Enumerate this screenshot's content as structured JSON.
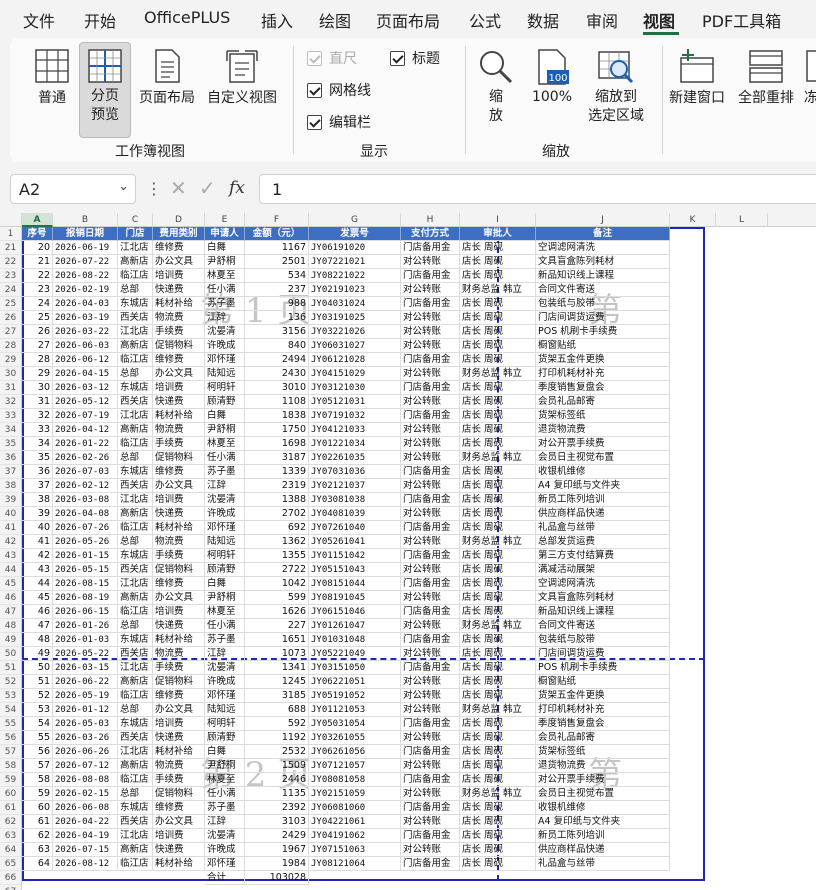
{
  "menu": {
    "items": [
      "文件",
      "开始",
      "OfficePLUS",
      "插入",
      "绘图",
      "页面布局",
      "公式",
      "数据",
      "审阅",
      "视图",
      "PDF工具箱"
    ],
    "active": "视图"
  },
  "ribbon": {
    "normal": "普通",
    "pagebreak_line1": "分页",
    "pagebreak_line2": "预览",
    "pagelayout": "页面布局",
    "customview": "自定义视图",
    "group_workbook_views": "工作簿视图",
    "ruler": "直尺",
    "headings": "标题",
    "gridlines": "网格线",
    "formulabar": "编辑栏",
    "group_show": "显示",
    "zoom_line1": "缩",
    "zoom_line2": "放",
    "zoom100": "100%",
    "zoom_sel_line1": "缩放到",
    "zoom_sel_line2": "选定区域",
    "group_zoom": "缩放",
    "new_window": "新建窗口",
    "arrange_all": "全部重排",
    "freeze": "冻"
  },
  "formula_bar": {
    "namebox": "A2",
    "formula": "1"
  },
  "columns": [
    "A",
    "B",
    "C",
    "D",
    "E",
    "F",
    "G",
    "H",
    "I",
    "J",
    "K",
    "L"
  ],
  "table_headers": [
    "序号",
    "报销日期",
    "门店",
    "费用类别",
    "申请人",
    "金额（元）",
    "发票号",
    "支付方式",
    "审批人",
    "备注"
  ],
  "rows": [
    [
      "20",
      "2026-06-19",
      "江北店",
      "维修费",
      "白舞",
      "1167",
      "JY06191020",
      "门店备用金",
      "店长 周砚",
      "空调滤网清洗"
    ],
    [
      "21",
      "2026-07-22",
      "高新店",
      "办公文具",
      "尹舒桐",
      "2501",
      "JY07221021",
      "对公转账",
      "店长 周砚",
      "文具盲盒陈列耗材"
    ],
    [
      "22",
      "2026-08-22",
      "临江店",
      "培训费",
      "林夏至",
      "534",
      "JY08221022",
      "门店备用金",
      "店长 周砚",
      "新品知识线上课程"
    ],
    [
      "23",
      "2026-02-19",
      "总部",
      "快递费",
      "任小满",
      "237",
      "JY02191023",
      "对公转账",
      "财务总监 韩立",
      "合同文件寄送"
    ],
    [
      "24",
      "2026-04-03",
      "东城店",
      "耗材补给",
      "苏子墨",
      "988",
      "JY04031024",
      "门店备用金",
      "店长 周砚",
      "包装纸与胶带"
    ],
    [
      "25",
      "2026-03-19",
      "西关店",
      "物流费",
      "江辞",
      "136",
      "JY03191025",
      "对公转账",
      "店长 周砚",
      "门店间调货运费"
    ],
    [
      "26",
      "2026-03-22",
      "江北店",
      "手续费",
      "沈晏清",
      "3156",
      "JY03221026",
      "对公转账",
      "店长 周砚",
      "POS 机刷卡手续费"
    ],
    [
      "27",
      "2026-06-03",
      "高新店",
      "促销物料",
      "许晚成",
      "840",
      "JY06031027",
      "对公转账",
      "店长 周砚",
      "橱窗贴纸"
    ],
    [
      "28",
      "2026-06-12",
      "临江店",
      "维修费",
      "邓怀瑾",
      "2494",
      "JY06121028",
      "门店备用金",
      "店长 周砚",
      "货架五金件更换"
    ],
    [
      "29",
      "2026-04-15",
      "总部",
      "办公文具",
      "陆知远",
      "2430",
      "JY04151029",
      "对公转账",
      "财务总监 韩立",
      "打印机耗材补充"
    ],
    [
      "30",
      "2026-03-12",
      "东城店",
      "培训费",
      "柯明轩",
      "3010",
      "JY03121030",
      "门店备用金",
      "店长 周砚",
      "季度销售复盘会"
    ],
    [
      "31",
      "2026-05-12",
      "西关店",
      "快递费",
      "顾清野",
      "1108",
      "JY05121031",
      "对公转账",
      "店长 周砚",
      "会员礼品邮寄"
    ],
    [
      "32",
      "2026-07-19",
      "江北店",
      "耗材补给",
      "白舞",
      "1838",
      "JY07191032",
      "门店备用金",
      "店长 周砚",
      "货架标签纸"
    ],
    [
      "33",
      "2026-04-12",
      "高新店",
      "物流费",
      "尹舒桐",
      "1750",
      "JY04121033",
      "对公转账",
      "店长 周砚",
      "退货物流费"
    ],
    [
      "34",
      "2026-01-22",
      "临江店",
      "手续费",
      "林夏至",
      "1698",
      "JY01221034",
      "对公转账",
      "店长 周砚",
      "对公开票手续费"
    ],
    [
      "35",
      "2026-02-26",
      "总部",
      "促销物料",
      "任小满",
      "3187",
      "JY02261035",
      "对公转账",
      "财务总监 韩立",
      "会员日主视觉布置"
    ],
    [
      "36",
      "2026-07-03",
      "东城店",
      "维修费",
      "苏子墨",
      "1339",
      "JY07031036",
      "门店备用金",
      "店长 周砚",
      "收银机维修"
    ],
    [
      "37",
      "2026-02-12",
      "西关店",
      "办公文具",
      "江辞",
      "2319",
      "JY02121037",
      "对公转账",
      "店长 周砚",
      "A4 复印纸与文件夹"
    ],
    [
      "38",
      "2026-03-08",
      "江北店",
      "培训费",
      "沈晏清",
      "1388",
      "JY03081038",
      "门店备用金",
      "店长 周砚",
      "新员工陈列培训"
    ],
    [
      "39",
      "2026-04-08",
      "高新店",
      "快递费",
      "许晚成",
      "2702",
      "JY04081039",
      "对公转账",
      "店长 周砚",
      "供应商样品快递"
    ],
    [
      "40",
      "2026-07-26",
      "临江店",
      "耗材补给",
      "邓怀瑾",
      "692",
      "JY07261040",
      "门店备用金",
      "店长 周砚",
      "礼品盒与丝带"
    ],
    [
      "41",
      "2026-05-26",
      "总部",
      "物流费",
      "陆知远",
      "1362",
      "JY05261041",
      "对公转账",
      "财务总监 韩立",
      "总部发货运费"
    ],
    [
      "42",
      "2026-01-15",
      "东城店",
      "手续费",
      "柯明轩",
      "1355",
      "JY01151042",
      "门店备用金",
      "店长 周砚",
      "第三方支付结算费"
    ],
    [
      "43",
      "2026-05-15",
      "西关店",
      "促销物料",
      "顾清野",
      "2722",
      "JY05151043",
      "对公转账",
      "店长 周砚",
      "满减活动展架"
    ],
    [
      "44",
      "2026-08-15",
      "江北店",
      "维修费",
      "白舞",
      "1042",
      "JY08151044",
      "门店备用金",
      "店长 周砚",
      "空调滤网清洗"
    ],
    [
      "45",
      "2026-08-19",
      "高新店",
      "办公文具",
      "尹舒桐",
      "599",
      "JY08191045",
      "对公转账",
      "店长 周砚",
      "文具盲盒陈列耗材"
    ],
    [
      "46",
      "2026-06-15",
      "临江店",
      "培训费",
      "林夏至",
      "1626",
      "JY06151046",
      "门店备用金",
      "店长 周砚",
      "新品知识线上课程"
    ],
    [
      "47",
      "2026-01-26",
      "总部",
      "快递费",
      "任小满",
      "227",
      "JY01261047",
      "对公转账",
      "财务总监 韩立",
      "合同文件寄送"
    ],
    [
      "48",
      "2026-01-03",
      "东城店",
      "耗材补给",
      "苏子墨",
      "1651",
      "JY01031048",
      "门店备用金",
      "店长 周砚",
      "包装纸与胶带"
    ],
    [
      "49",
      "2026-05-22",
      "西关店",
      "物流费",
      "江辞",
      "1073",
      "JY05221049",
      "对公转账",
      "店长 周砚",
      "门店间调货运费"
    ],
    [
      "50",
      "2026-03-15",
      "江北店",
      "手续费",
      "沈晏清",
      "1341",
      "JY03151050",
      "门店备用金",
      "店长 周砚",
      "POS 机刷卡手续费"
    ],
    [
      "51",
      "2026-06-22",
      "高新店",
      "促销物料",
      "许晚成",
      "1245",
      "JY06221051",
      "对公转账",
      "店长 周砚",
      "橱窗贴纸"
    ],
    [
      "52",
      "2026-05-19",
      "临江店",
      "维修费",
      "邓怀瑾",
      "3185",
      "JY05191052",
      "对公转账",
      "店长 周砚",
      "货架五金件更换"
    ],
    [
      "53",
      "2026-01-12",
      "总部",
      "办公文具",
      "陆知远",
      "688",
      "JY01121053",
      "对公转账",
      "财务总监 韩立",
      "打印机耗材补充"
    ],
    [
      "54",
      "2026-05-03",
      "东城店",
      "培训费",
      "柯明轩",
      "592",
      "JY05031054",
      "门店备用金",
      "店长 周砚",
      "季度销售复盘会"
    ],
    [
      "55",
      "2026-03-26",
      "西关店",
      "快递费",
      "顾清野",
      "1192",
      "JY03261055",
      "对公转账",
      "店长 周砚",
      "会员礼品邮寄"
    ],
    [
      "56",
      "2026-06-26",
      "江北店",
      "耗材补给",
      "白舞",
      "2532",
      "JY06261056",
      "门店备用金",
      "店长 周砚",
      "货架标签纸"
    ],
    [
      "57",
      "2026-07-12",
      "高新店",
      "物流费",
      "尹舒桐",
      "1509",
      "JY07121057",
      "对公转账",
      "店长 周砚",
      "退货物流费"
    ],
    [
      "58",
      "2026-08-08",
      "临江店",
      "手续费",
      "林夏至",
      "2446",
      "JY08081058",
      "门店备用金",
      "店长 周砚",
      "对公开票手续费"
    ],
    [
      "59",
      "2026-02-15",
      "总部",
      "促销物料",
      "任小满",
      "1135",
      "JY02151059",
      "对公转账",
      "财务总监 韩立",
      "会员日主视觉布置"
    ],
    [
      "60",
      "2026-06-08",
      "东城店",
      "维修费",
      "苏子墨",
      "2392",
      "JY06081060",
      "门店备用金",
      "店长 周砚",
      "收银机维修"
    ],
    [
      "61",
      "2026-04-22",
      "西关店",
      "办公文具",
      "江辞",
      "3103",
      "JY04221061",
      "对公转账",
      "店长 周砚",
      "A4 复印纸与文件夹"
    ],
    [
      "62",
      "2026-04-19",
      "江北店",
      "培训费",
      "沈晏清",
      "2429",
      "JY04191062",
      "门店备用金",
      "店长 周砚",
      "新员工陈列培训"
    ],
    [
      "63",
      "2026-07-15",
      "高新店",
      "快递费",
      "许晚成",
      "1967",
      "JY07151063",
      "对公转账",
      "店长 周砚",
      "供应商样品快递"
    ],
    [
      "64",
      "2026-08-12",
      "临江店",
      "耗材补给",
      "邓怀瑾",
      "1984",
      "JY08121064",
      "门店备用金",
      "店长 周砚",
      "礼品盒与丝带"
    ]
  ],
  "total_row": {
    "label": "合计",
    "value": "103028"
  },
  "row_numbers": [
    "1",
    "21",
    "22",
    "23",
    "24",
    "25",
    "26",
    "27",
    "28",
    "29",
    "30",
    "31",
    "32",
    "33",
    "34",
    "35",
    "36",
    "37",
    "38",
    "39",
    "40",
    "41",
    "42",
    "43",
    "44",
    "45",
    "46",
    "47",
    "48",
    "49",
    "50",
    "51",
    "52",
    "53",
    "54",
    "55",
    "56",
    "57",
    "58",
    "59",
    "60",
    "61",
    "62",
    "63",
    "64",
    "65",
    "66",
    "67"
  ],
  "watermarks": {
    "page1": "第 1 页",
    "page2": "第 2 页",
    "page3_partial": "第",
    "page4_partial": "第"
  },
  "colors": {
    "header_fill": "#3c6fc4",
    "page_border": "#1c28b8",
    "accent": "#1e7145"
  }
}
